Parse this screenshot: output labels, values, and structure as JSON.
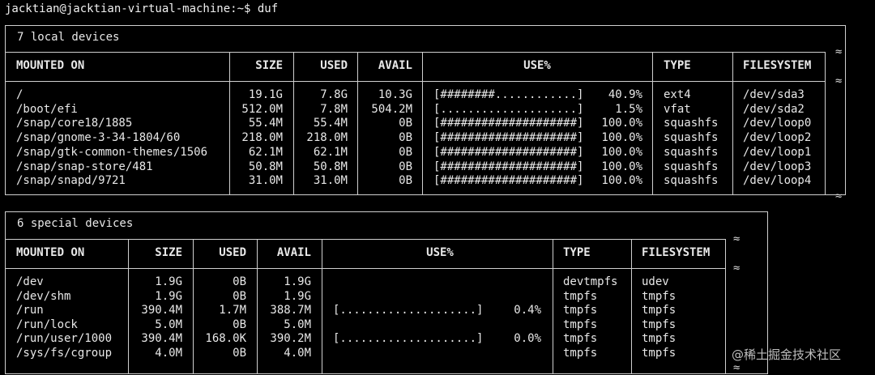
{
  "terminal": {
    "prompt": "jacktian@jacktian-virtual-machine:~$ duf"
  },
  "local": {
    "title": "7 local devices",
    "headers": [
      "MOUNTED ON",
      "SIZE",
      "USED",
      "AVAIL",
      "USE%",
      "TYPE",
      "FILESYSTEM"
    ],
    "rows": [
      {
        "mount": "/",
        "size": "19.1G",
        "used": "7.8G",
        "avail": "10.3G",
        "bar": "[########............]",
        "pct": "40.9%",
        "type": "ext4",
        "fs": "/dev/sda3"
      },
      {
        "mount": "/boot/efi",
        "size": "512.0M",
        "used": "7.8M",
        "avail": "504.2M",
        "bar": "[....................]",
        "pct": "1.5%",
        "type": "vfat",
        "fs": "/dev/sda2"
      },
      {
        "mount": "/snap/core18/1885",
        "size": "55.4M",
        "used": "55.4M",
        "avail": "0B",
        "bar": "[####################]",
        "pct": "100.0%",
        "type": "squashfs",
        "fs": "/dev/loop0"
      },
      {
        "mount": "/snap/gnome-3-34-1804/60",
        "size": "218.0M",
        "used": "218.0M",
        "avail": "0B",
        "bar": "[####################]",
        "pct": "100.0%",
        "type": "squashfs",
        "fs": "/dev/loop2"
      },
      {
        "mount": "/snap/gtk-common-themes/1506",
        "size": "62.1M",
        "used": "62.1M",
        "avail": "0B",
        "bar": "[####################]",
        "pct": "100.0%",
        "type": "squashfs",
        "fs": "/dev/loop1"
      },
      {
        "mount": "/snap/snap-store/481",
        "size": "50.8M",
        "used": "50.8M",
        "avail": "0B",
        "bar": "[####################]",
        "pct": "100.0%",
        "type": "squashfs",
        "fs": "/dev/loop3"
      },
      {
        "mount": "/snap/snapd/9721",
        "size": "31.0M",
        "used": "31.0M",
        "avail": "0B",
        "bar": "[####################]",
        "pct": "100.0%",
        "type": "squashfs",
        "fs": "/dev/loop4"
      }
    ]
  },
  "special": {
    "title": "6 special devices",
    "headers": [
      "MOUNTED ON",
      "SIZE",
      "USED",
      "AVAIL",
      "USE%",
      "TYPE",
      "FILESYSTEM"
    ],
    "rows": [
      {
        "mount": "/dev",
        "size": "1.9G",
        "used": "0B",
        "avail": "1.9G",
        "bar": "",
        "pct": "",
        "type": "devtmpfs",
        "fs": "udev"
      },
      {
        "mount": "/dev/shm",
        "size": "1.9G",
        "used": "0B",
        "avail": "1.9G",
        "bar": "",
        "pct": "",
        "type": "tmpfs",
        "fs": "tmpfs"
      },
      {
        "mount": "/run",
        "size": "390.4M",
        "used": "1.7M",
        "avail": "388.7M",
        "bar": "[....................]",
        "pct": "0.4%",
        "type": "tmpfs",
        "fs": "tmpfs"
      },
      {
        "mount": "/run/lock",
        "size": "5.0M",
        "used": "0B",
        "avail": "5.0M",
        "bar": "",
        "pct": "",
        "type": "tmpfs",
        "fs": "tmpfs"
      },
      {
        "mount": "/run/user/1000",
        "size": "390.4M",
        "used": "168.0K",
        "avail": "390.2M",
        "bar": "[....................]",
        "pct": "0.0%",
        "type": "tmpfs",
        "fs": "tmpfs"
      },
      {
        "mount": "/sys/fs/cgroup",
        "size": "4.0M",
        "used": "0B",
        "avail": "4.0M",
        "bar": "",
        "pct": "",
        "type": "tmpfs",
        "fs": "tmpfs"
      }
    ]
  },
  "wrap_marker": "≈",
  "watermark": "@稀土掘金技术社区"
}
